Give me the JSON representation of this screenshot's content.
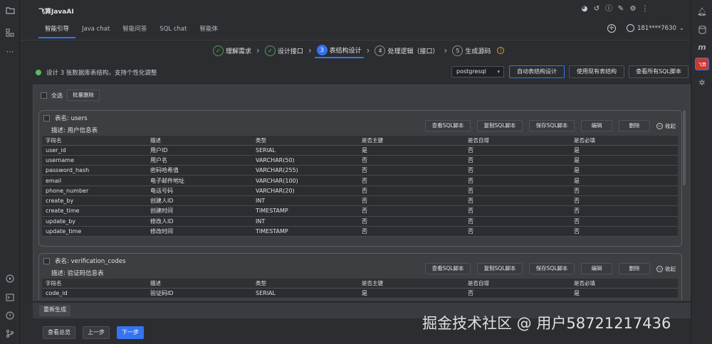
{
  "app": {
    "title": "飞算JavaAI"
  },
  "tabs": [
    {
      "label": "智能引导",
      "active": true
    },
    {
      "label": "Java chat",
      "active": false
    },
    {
      "label": "智能问答",
      "active": false
    },
    {
      "label": "SQL chat",
      "active": false
    },
    {
      "label": "智能体",
      "active": false
    }
  ],
  "user": {
    "phone": "181****7630"
  },
  "steps": [
    {
      "num": "✓",
      "label": "理解需求",
      "state": "done"
    },
    {
      "num": "✓",
      "label": "设计接口",
      "state": "done"
    },
    {
      "num": "3",
      "label": "表结构设计",
      "state": "current"
    },
    {
      "num": "4",
      "label": "处理逻辑（接口）",
      "state": "todo"
    },
    {
      "num": "5",
      "label": "生成源码",
      "state": "todo"
    }
  ],
  "status": {
    "text": "设计 3 张数据库表结构，支持个性化调整",
    "color": "#5fb865"
  },
  "header_actions": {
    "db_type": "postgresql",
    "auto_design": "自动表结构设计",
    "use_existing": "使用现有表结构",
    "view_all_sql": "查看所有SQL脚本"
  },
  "toolbar": {
    "select_all": "全选",
    "bulk_delete": "批量删除"
  },
  "card_actions": {
    "view_sql": "查看SQL脚本",
    "copy_sql": "复制SQL脚本",
    "save_sql": "保存SQL脚本",
    "edit": "编辑",
    "delete": "删除",
    "collapse": "收起"
  },
  "columns": [
    "字段名",
    "描述",
    "类型",
    "是否主键",
    "是否自增",
    "是否必填"
  ],
  "tables": [
    {
      "name": "表名: users",
      "desc": "描述: 用户信息表",
      "rows": [
        [
          "user_id",
          "用户ID",
          "SERIAL",
          "是",
          "否",
          "是"
        ],
        [
          "username",
          "用户名",
          "VARCHAR(50)",
          "否",
          "否",
          "是"
        ],
        [
          "password_hash",
          "密码哈希值",
          "VARCHAR(255)",
          "否",
          "否",
          "是"
        ],
        [
          "email",
          "电子邮件地址",
          "VARCHAR(100)",
          "否",
          "否",
          "是"
        ],
        [
          "phone_number",
          "电话号码",
          "VARCHAR(20)",
          "否",
          "否",
          "否"
        ],
        [
          "create_by",
          "创建人ID",
          "INT",
          "否",
          "否",
          "否"
        ],
        [
          "create_time",
          "创建时间",
          "TIMESTAMP",
          "否",
          "否",
          "否"
        ],
        [
          "update_by",
          "修改人ID",
          "INT",
          "否",
          "否",
          "否"
        ],
        [
          "update_time",
          "修改时间",
          "TIMESTAMP",
          "否",
          "否",
          "否"
        ]
      ]
    },
    {
      "name": "表名: verification_codes",
      "desc": "描述: 验证码信息表",
      "rows": [
        [
          "code_id",
          "验证码ID",
          "SERIAL",
          "是",
          "否",
          "是"
        ]
      ]
    }
  ],
  "footer": {
    "regenerate": "重新生成",
    "overview": "查看总览",
    "prev": "上一步",
    "next": "下一步"
  },
  "watermark": "掘金技术社区 @ 用户58721217436"
}
